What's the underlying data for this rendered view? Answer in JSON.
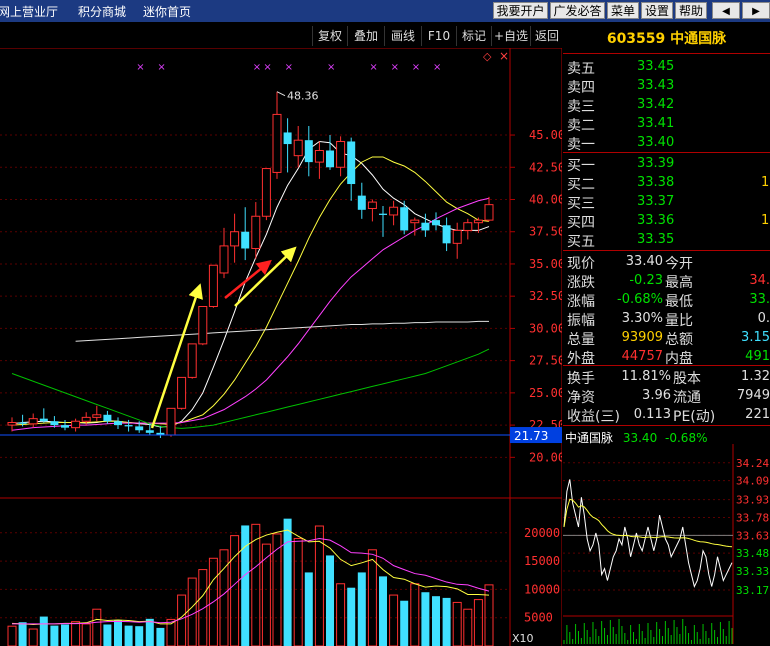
{
  "topbar": {
    "links": [
      "网上营业厅",
      "积分商城",
      "迷你首页"
    ],
    "buttons": [
      "我要开户",
      "广发必答",
      "菜单",
      "设置",
      "帮助"
    ],
    "arrow_left": "◀",
    "arrow_right": "▶"
  },
  "toolbar": {
    "buttons": [
      "复权",
      "叠加",
      "画线",
      "F10",
      "标记",
      "+自选",
      "返回"
    ],
    "flag": "◇",
    "close": "×"
  },
  "stock": {
    "code": "603559",
    "name": "中通国脉"
  },
  "quotes": {
    "sell": [
      {
        "label": "卖五",
        "price": "33.45"
      },
      {
        "label": "卖四",
        "price": "33.43"
      },
      {
        "label": "卖三",
        "price": "33.42"
      },
      {
        "label": "卖二",
        "price": "33.41"
      },
      {
        "label": "卖一",
        "price": "33.40"
      }
    ],
    "buy": [
      {
        "label": "买一",
        "price": "33.39",
        "vol": ""
      },
      {
        "label": "买二",
        "price": "33.38",
        "vol": "1"
      },
      {
        "label": "买三",
        "price": "33.37",
        "vol": ""
      },
      {
        "label": "买四",
        "price": "33.36",
        "vol": "1"
      },
      {
        "label": "买五",
        "price": "33.35",
        "vol": ""
      }
    ]
  },
  "stats": [
    {
      "l1": "现价",
      "v1": "33.40",
      "l2": "今开",
      "v2": "",
      "c1": "#e0e0e0",
      "c2": "#ff3030"
    },
    {
      "l1": "涨跌",
      "v1": "-0.23",
      "l2": "最高",
      "v2": "34.",
      "c1": "#00e000",
      "c2": "#ff3030"
    },
    {
      "l1": "涨幅",
      "v1": "-0.68%",
      "l2": "最低",
      "v2": "33.",
      "c1": "#00e000",
      "c2": "#00e000"
    },
    {
      "l1": "振幅",
      "v1": "3.30%",
      "l2": "量比",
      "v2": "0.",
      "c1": "#e0e0e0",
      "c2": "#e0e0e0"
    },
    {
      "l1": "总量",
      "v1": "93909",
      "l2": "总额",
      "v2": "3.15",
      "c1": "#ffd000",
      "c2": "#40e0ff"
    },
    {
      "l1": "外盘",
      "v1": "44757",
      "l2": "内盘",
      "v2": "491",
      "c1": "#ff3030",
      "c2": "#00e000"
    }
  ],
  "stats2": [
    {
      "l1": "换手",
      "v1": "11.81%",
      "l2": "股本",
      "v2": "1.32"
    },
    {
      "l1": "净资",
      "v1": "3.96",
      "l2": "流通",
      "v2": "7949"
    },
    {
      "l1": "收益(三)",
      "v1": "0.113",
      "l2": "PE(动)",
      "v2": "221"
    }
  ],
  "mini_chart": {
    "title": "中通国脉",
    "price": "33.40",
    "change": "-0.68%",
    "ticks": [
      "34.24",
      "34.09",
      "33.93",
      "33.78",
      "33.63",
      "33.48",
      "33.33",
      "33.17"
    ],
    "series": [
      33.7,
      34.0,
      34.1,
      33.9,
      33.8,
      33.7,
      33.95,
      33.8,
      33.6,
      33.5,
      33.55,
      33.65,
      33.55,
      33.3,
      33.35,
      33.25,
      33.35,
      33.45,
      33.5,
      33.6,
      33.55,
      33.7,
      33.6,
      33.45,
      33.55,
      33.65,
      33.55,
      33.5,
      33.6,
      33.7,
      33.6,
      33.5,
      33.6,
      33.8,
      33.7,
      33.6,
      33.55,
      33.45,
      33.5,
      33.55,
      33.6,
      33.7,
      33.55,
      33.4,
      33.3,
      33.2,
      33.25,
      33.35,
      33.5,
      33.45,
      33.3,
      33.2,
      33.3,
      33.45,
      33.35,
      33.25,
      33.3,
      33.35,
      33.4
    ]
  },
  "kline": {
    "price_ticks": [
      "45.00",
      "42.50",
      "40.00",
      "37.50",
      "35.00",
      "32.50",
      "30.00",
      "27.50",
      "25.00",
      "22.50",
      "20.00"
    ],
    "tick_values": [
      45.0,
      42.5,
      40.0,
      37.5,
      35.0,
      32.5,
      30.0,
      27.5,
      25.0,
      22.5,
      20.0
    ],
    "high_label": "48.36",
    "current_price_tag": "21.73",
    "vol_ticks": [
      "20000",
      "15000",
      "10000",
      "5000"
    ],
    "vol_tick_values": [
      20000,
      15000,
      10000,
      5000
    ],
    "vol_unit": "X10",
    "marker_glyph": "×",
    "candles": [
      {
        "o": 22.5,
        "h": 23.1,
        "l": 22.0,
        "c": 22.7
      },
      {
        "o": 22.7,
        "h": 23.3,
        "l": 22.4,
        "c": 22.6
      },
      {
        "o": 22.6,
        "h": 23.4,
        "l": 22.3,
        "c": 23.0
      },
      {
        "o": 23.0,
        "h": 23.8,
        "l": 22.7,
        "c": 22.8
      },
      {
        "o": 22.8,
        "h": 23.2,
        "l": 22.3,
        "c": 22.5
      },
      {
        "o": 22.5,
        "h": 22.9,
        "l": 22.1,
        "c": 22.3
      },
      {
        "o": 22.3,
        "h": 23.0,
        "l": 22.0,
        "c": 22.8
      },
      {
        "o": 22.8,
        "h": 23.5,
        "l": 22.5,
        "c": 23.1
      },
      {
        "o": 23.1,
        "h": 24.0,
        "l": 22.8,
        "c": 23.3
      },
      {
        "o": 23.3,
        "h": 23.6,
        "l": 22.6,
        "c": 22.8
      },
      {
        "o": 22.8,
        "h": 23.1,
        "l": 22.2,
        "c": 22.5
      },
      {
        "o": 22.5,
        "h": 22.9,
        "l": 22.0,
        "c": 22.4
      },
      {
        "o": 22.4,
        "h": 22.8,
        "l": 21.9,
        "c": 22.1
      },
      {
        "o": 22.1,
        "h": 22.6,
        "l": 21.7,
        "c": 21.9
      },
      {
        "o": 21.9,
        "h": 22.4,
        "l": 21.5,
        "c": 21.73
      },
      {
        "o": 21.73,
        "h": 23.8,
        "l": 21.6,
        "c": 23.8
      },
      {
        "o": 23.8,
        "h": 26.2,
        "l": 23.7,
        "c": 26.2
      },
      {
        "o": 26.2,
        "h": 28.8,
        "l": 26.1,
        "c": 28.8
      },
      {
        "o": 28.8,
        "h": 31.7,
        "l": 28.7,
        "c": 31.7
      },
      {
        "o": 31.7,
        "h": 34.9,
        "l": 31.6,
        "c": 34.9
      },
      {
        "o": 34.3,
        "h": 37.8,
        "l": 33.9,
        "c": 36.4
      },
      {
        "o": 36.4,
        "h": 38.9,
        "l": 35.1,
        "c": 37.5
      },
      {
        "o": 37.5,
        "h": 39.4,
        "l": 35.3,
        "c": 36.2
      },
      {
        "o": 36.2,
        "h": 39.8,
        "l": 35.4,
        "c": 38.7
      },
      {
        "o": 38.7,
        "h": 42.4,
        "l": 38.4,
        "c": 42.4
      },
      {
        "o": 42.1,
        "h": 48.36,
        "l": 41.6,
        "c": 46.6
      },
      {
        "o": 45.2,
        "h": 46.3,
        "l": 42.1,
        "c": 44.3
      },
      {
        "o": 43.4,
        "h": 45.7,
        "l": 42.5,
        "c": 44.6
      },
      {
        "o": 44.6,
        "h": 45.7,
        "l": 41.8,
        "c": 42.9
      },
      {
        "o": 42.9,
        "h": 44.5,
        "l": 41.6,
        "c": 43.8
      },
      {
        "o": 43.8,
        "h": 45.0,
        "l": 42.3,
        "c": 42.5
      },
      {
        "o": 42.5,
        "h": 44.9,
        "l": 41.8,
        "c": 44.5
      },
      {
        "o": 44.5,
        "h": 44.8,
        "l": 39.9,
        "c": 41.2
      },
      {
        "o": 40.3,
        "h": 41.3,
        "l": 38.5,
        "c": 39.2
      },
      {
        "o": 39.3,
        "h": 40.0,
        "l": 38.3,
        "c": 39.8
      },
      {
        "o": 38.9,
        "h": 39.5,
        "l": 37.1,
        "c": 38.8
      },
      {
        "o": 38.8,
        "h": 39.9,
        "l": 38.0,
        "c": 39.4
      },
      {
        "o": 39.4,
        "h": 39.9,
        "l": 37.3,
        "c": 37.6
      },
      {
        "o": 38.2,
        "h": 38.6,
        "l": 37.2,
        "c": 38.4
      },
      {
        "o": 38.2,
        "h": 38.9,
        "l": 37.1,
        "c": 37.6
      },
      {
        "o": 38.4,
        "h": 39.0,
        "l": 37.6,
        "c": 38.0
      },
      {
        "o": 38.0,
        "h": 38.6,
        "l": 36.0,
        "c": 36.6
      },
      {
        "o": 36.6,
        "h": 38.2,
        "l": 35.4,
        "c": 37.6
      },
      {
        "o": 37.6,
        "h": 38.5,
        "l": 36.9,
        "c": 38.2
      },
      {
        "o": 38.2,
        "h": 38.6,
        "l": 37.4,
        "c": 38.4
      },
      {
        "o": 38.4,
        "h": 40.2,
        "l": 38.3,
        "c": 39.6
      }
    ],
    "volumes": [
      3500,
      4200,
      3000,
      5200,
      3600,
      3800,
      4300,
      3900,
      6500,
      3800,
      4600,
      3600,
      3500,
      4800,
      3200,
      4700,
      9000,
      12000,
      13500,
      15500,
      17000,
      19500,
      21300,
      21500,
      18000,
      19800,
      22500,
      19000,
      13000,
      21200,
      16000,
      11000,
      10300,
      13000,
      17000,
      12300,
      9000,
      8000,
      11000,
      9500,
      8800,
      8500,
      7700,
      6500,
      8200,
      10800
    ],
    "ma_price": [
      {
        "name": "MA5",
        "color": "#ffffff",
        "values": [
          22.6,
          22.7,
          22.75,
          22.8,
          22.75,
          22.7,
          22.7,
          22.65,
          22.7,
          22.85,
          22.8,
          22.7,
          22.6,
          22.55,
          22.35,
          22.4,
          22.8,
          23.7,
          25.0,
          27.0,
          29.1,
          31.3,
          33.6,
          35.5,
          37.3,
          39.4,
          41.1,
          42.4,
          43.9,
          44.5,
          44.4,
          43.6,
          43.4,
          42.8,
          41.9,
          40.8,
          40.1,
          39.6,
          38.9,
          38.5,
          38.1,
          37.8,
          37.6,
          37.6,
          37.6,
          37.9
        ]
      },
      {
        "name": "MA10",
        "color": "#ffff40",
        "values": [
          22.5,
          22.55,
          22.6,
          22.65,
          22.7,
          22.7,
          22.7,
          22.7,
          22.75,
          22.8,
          22.8,
          22.7,
          22.65,
          22.65,
          22.6,
          22.55,
          22.7,
          23.0,
          23.3,
          24.0,
          24.9,
          26.0,
          27.3,
          28.6,
          30.1,
          31.8,
          33.5,
          35.2,
          37.0,
          38.6,
          40.0,
          41.2,
          42.1,
          42.9,
          43.3,
          43.3,
          42.9,
          42.6,
          42.1,
          41.4,
          40.6,
          39.8,
          39.3,
          38.9,
          38.4,
          38.3
        ]
      },
      {
        "name": "MA20",
        "color": "#ff40ff",
        "values": [
          22.1,
          22.2,
          22.3,
          22.35,
          22.4,
          22.45,
          22.5,
          22.5,
          22.55,
          22.6,
          22.65,
          22.65,
          22.65,
          22.65,
          22.65,
          22.65,
          22.7,
          22.85,
          23.0,
          23.35,
          23.7,
          24.2,
          24.7,
          25.3,
          26.0,
          26.9,
          27.8,
          28.8,
          29.9,
          31.0,
          32.1,
          33.1,
          34.0,
          34.7,
          35.4,
          36.1,
          36.6,
          37.1,
          37.6,
          38.0,
          38.5,
          38.9,
          39.3,
          39.6,
          39.9,
          40.1
        ]
      },
      {
        "name": "MA60",
        "color": "#00c000",
        "values": [
          26.5,
          26.2,
          25.9,
          25.6,
          25.3,
          25.0,
          24.7,
          24.4,
          24.1,
          23.8,
          23.5,
          23.2,
          22.9,
          22.6,
          22.4,
          22.3,
          22.25,
          22.3,
          22.4,
          22.5,
          22.7,
          22.9,
          23.1,
          23.3,
          23.5,
          23.7,
          23.9,
          24.1,
          24.3,
          24.5,
          24.7,
          24.9,
          25.1,
          25.3,
          25.5,
          25.7,
          25.9,
          26.1,
          26.3,
          26.5,
          26.8,
          27.1,
          27.4,
          27.7,
          28.0,
          28.4
        ]
      },
      {
        "name": "MA120",
        "color": "#e0e0e0",
        "values": [
          null,
          null,
          null,
          null,
          null,
          null,
          29.0,
          29.05,
          29.1,
          29.15,
          29.2,
          29.25,
          29.3,
          29.35,
          29.4,
          29.45,
          29.5,
          29.55,
          29.6,
          29.65,
          29.7,
          29.75,
          29.8,
          29.85,
          29.9,
          29.95,
          30.0,
          30.05,
          30.1,
          30.15,
          30.2,
          30.25,
          30.3,
          30.3,
          30.35,
          30.35,
          30.4,
          30.4,
          30.45,
          30.45,
          30.5,
          30.5,
          30.5,
          30.5,
          30.55,
          30.55
        ]
      }
    ],
    "ma_vol": [
      {
        "name": "VMA5",
        "color": "#ffff40",
        "values": [
          4000,
          3900,
          3800,
          3900,
          3900,
          4000,
          4000,
          4100,
          4700,
          4500,
          4600,
          4500,
          4300,
          4400,
          3900,
          3900,
          5100,
          6900,
          8900,
          11700,
          13700,
          15800,
          17600,
          18800,
          19600,
          20100,
          20500,
          19400,
          18400,
          18500,
          17300,
          15300,
          14200,
          14700,
          15300,
          13500,
          12100,
          11800,
          11000,
          10400,
          10600,
          10500,
          10100,
          9100,
          9100,
          9000
        ]
      },
      {
        "name": "VMA10",
        "color": "#ff40ff",
        "values": [
          3900,
          3900,
          3900,
          3900,
          3900,
          3950,
          3950,
          4000,
          4200,
          4300,
          4350,
          4300,
          4200,
          4300,
          4100,
          4200,
          4800,
          5600,
          6600,
          7800,
          9200,
          10900,
          12600,
          14000,
          15600,
          17100,
          18400,
          18500,
          18600,
          19000,
          18700,
          17700,
          16500,
          16400,
          16200,
          15500,
          14200,
          13500,
          12800,
          12500,
          11900,
          11300,
          10900,
          10800,
          10200,
          9700
        ]
      }
    ],
    "markers_x_idx": [
      26,
      30,
      34,
      36,
      38,
      40
    ],
    "markers_top_idx": [
      12,
      14,
      23,
      24
    ]
  }
}
